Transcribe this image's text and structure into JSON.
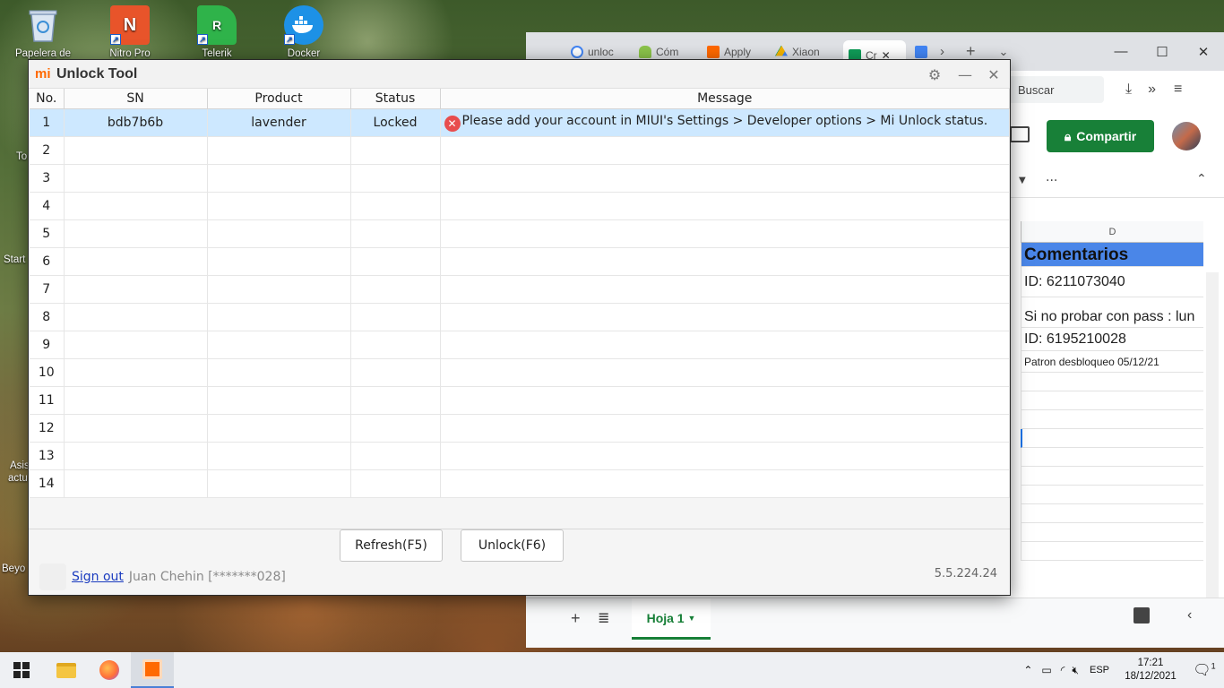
{
  "desktop": {
    "icons": [
      {
        "label": "Papelera de",
        "color": "#6ea0d8"
      },
      {
        "label": "Nitro Pro",
        "color": "#e8542a"
      },
      {
        "label": "Telerik Reporting",
        "color": "#2fb34a"
      },
      {
        "label": "Docker Desktop",
        "color": "#1d91e6"
      }
    ],
    "side_labels": [
      "To",
      "Start",
      "Asis",
      "actu",
      "Beyo"
    ]
  },
  "browser": {
    "tabs": [
      {
        "label": "unloc",
        "icon": "google-icon",
        "color": "#4285f4"
      },
      {
        "label": "Cóm",
        "icon": "android-icon",
        "color": "#8bc34a"
      },
      {
        "label": "Apply",
        "icon": "miui-icon",
        "color": "#ff6900"
      },
      {
        "label": "Xiaon",
        "icon": "drive-icon",
        "color": "#f4b400"
      },
      {
        "label": "Cr",
        "icon": "sheets-icon",
        "color": "#0f9d58"
      }
    ],
    "search_placeholder": "Buscar",
    "share_label": "Compartir",
    "column_letter": "D",
    "cells": [
      "Comentarios",
      "ID: 6211073040",
      "Si no probar con pass : lun",
      "ID: 6195210028",
      "Patron desbloqueo 05/12/21"
    ],
    "sheet_tab": "Hoja 1",
    "more_label": "···"
  },
  "app": {
    "title": "Unlock Tool",
    "columns": [
      "No.",
      "SN",
      "Product",
      "Status",
      "Message"
    ],
    "rows": [
      {
        "no": "1",
        "sn": "bdb7b6b",
        "product": "lavender",
        "status": "Locked",
        "message": "Please add your account in MIUI's Settings > Developer options > Mi Unlock status."
      },
      {
        "no": "2"
      },
      {
        "no": "3"
      },
      {
        "no": "4"
      },
      {
        "no": "5"
      },
      {
        "no": "6"
      },
      {
        "no": "7"
      },
      {
        "no": "8"
      },
      {
        "no": "9"
      },
      {
        "no": "10"
      },
      {
        "no": "11"
      },
      {
        "no": "12"
      },
      {
        "no": "13"
      },
      {
        "no": "14"
      }
    ],
    "refresh_label": "Refresh(F5)",
    "unlock_label": "Unlock(F6)",
    "signout_label": "Sign out",
    "account": "Juan Chehin [*******028]",
    "version": "5.5.224.24",
    "status_color": "#1233c8",
    "accent": "#ff6900"
  },
  "taskbar": {
    "lang": "ESP",
    "time": "17:21",
    "date": "18/12/2021",
    "notification_count": "1"
  }
}
